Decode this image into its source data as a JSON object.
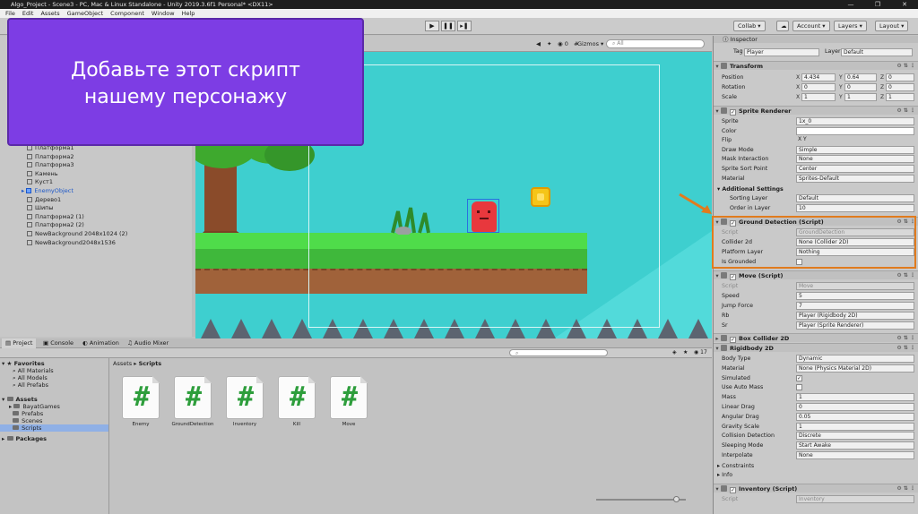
{
  "window": {
    "title": "Algo_Project - Scene3 - PC, Mac & Linux Standalone - Unity 2019.3.6f1 Personal* <DX11>",
    "menu": [
      "File",
      "Edit",
      "Assets",
      "GameObject",
      "Component",
      "Window",
      "Help"
    ]
  },
  "toolbar": {
    "collab": "Collab ▾",
    "account": "Account ▾",
    "layers": "Layers ▾",
    "layout": "Layout ▾"
  },
  "overlay": {
    "line1": "Добавьте этот скрипт",
    "line2": "нашему персонажу"
  },
  "hierarchy": {
    "items": [
      {
        "label": "Платформа1",
        "blue": false
      },
      {
        "label": "Платформа2",
        "blue": false
      },
      {
        "label": "Платформа3",
        "blue": false
      },
      {
        "label": "Камень",
        "blue": false
      },
      {
        "label": "Куст1",
        "blue": false
      },
      {
        "label": "EnemyObject",
        "blue": true
      },
      {
        "label": "Дерево1",
        "blue": false
      },
      {
        "label": "Шипы",
        "blue": false
      },
      {
        "label": "Платформа2 (1)",
        "blue": false
      },
      {
        "label": "Платформа2 (2)",
        "blue": false
      },
      {
        "label": "NewBackground 2048x1024 (2)",
        "blue": false
      },
      {
        "label": "NewBackground2048x1536",
        "blue": false
      }
    ]
  },
  "scene": {
    "gizmos": "Gizmos ▾",
    "search_placeholder": "All",
    "colors": {
      "sky": "#3ecfcf",
      "grass": "#4fdc4a",
      "dirt": "#a0623a",
      "player": "#e8383d",
      "coin": "#f5c518"
    }
  },
  "project": {
    "tabs": [
      "Project",
      "Console",
      "Animation",
      "Audio Mixer"
    ],
    "count": "17",
    "tree": {
      "favorites": "Favorites",
      "fav_items": [
        "All Materials",
        "All Models",
        "All Prefabs"
      ],
      "assets": "Assets",
      "asset_items": [
        "BayatGames",
        "Prefabs",
        "Scenes",
        "Scripts"
      ],
      "packages": "Packages"
    },
    "breadcrumb": {
      "root": "Assets",
      "sep": "▸",
      "current": "Scripts"
    },
    "files": [
      {
        "name": "Enemy"
      },
      {
        "name": "GroundDetection"
      },
      {
        "name": "Inventory"
      },
      {
        "name": "Kill"
      },
      {
        "name": "Move"
      }
    ]
  },
  "inspector": {
    "title": "Inspector",
    "tag_label": "Tag",
    "tag_value": "Player",
    "layer_label": "Layer",
    "layer_value": "Default",
    "transform": {
      "title": "Transform",
      "position": {
        "label": "Position",
        "x": "4.434",
        "y": "0.64",
        "z": "0"
      },
      "rotation": {
        "label": "Rotation",
        "x": "0",
        "y": "0",
        "z": "0"
      },
      "scale": {
        "label": "Scale",
        "x": "1",
        "y": "1",
        "z": "1"
      }
    },
    "sprite_renderer": {
      "title": "Sprite Renderer",
      "rows": [
        {
          "label": "Sprite",
          "value": "1x_0"
        },
        {
          "label": "Color",
          "value": ""
        },
        {
          "label": "Flip",
          "value": "X  Y"
        },
        {
          "label": "Draw Mode",
          "value": "Simple"
        },
        {
          "label": "Mask Interaction",
          "value": "None"
        },
        {
          "label": "Sprite Sort Point",
          "value": "Center"
        },
        {
          "label": "Material",
          "value": "Sprites-Default"
        }
      ],
      "additional": "Additional Settings",
      "sorting_layer": {
        "label": "Sorting Layer",
        "value": "Default"
      },
      "order_in_layer": {
        "label": "Order in Layer",
        "value": "10"
      }
    },
    "ground_detection": {
      "title": "Ground Detection (Script)",
      "script": {
        "label": "Script",
        "value": "GroundDetection"
      },
      "collider": {
        "label": "Collider 2d",
        "value": "None (Collider 2D)"
      },
      "platform": {
        "label": "Platform Layer",
        "value": "Nothing"
      },
      "grounded": {
        "label": "Is Grounded"
      }
    },
    "move": {
      "title": "Move (Script)",
      "script": {
        "label": "Script",
        "value": "Move"
      },
      "speed": {
        "label": "Speed",
        "value": "5"
      },
      "jump": {
        "label": "Jump Force",
        "value": "7"
      },
      "rb": {
        "label": "Rb",
        "value": "Player (Rigidbody 2D)"
      },
      "sr": {
        "label": "Sr",
        "value": "Player (Sprite Renderer)"
      }
    },
    "box_collider": {
      "title": "Box Collider 2D"
    },
    "rigidbody": {
      "title": "Rigidbody 2D",
      "rows": [
        {
          "label": "Body Type",
          "value": "Dynamic"
        },
        {
          "label": "Material",
          "value": "None (Physics Material 2D)"
        },
        {
          "label": "Simulated",
          "value": "✓"
        },
        {
          "label": "Use Auto Mass",
          "value": ""
        },
        {
          "label": "Mass",
          "value": "1"
        },
        {
          "label": "Linear Drag",
          "value": "0"
        },
        {
          "label": "Angular Drag",
          "value": "0.05"
        },
        {
          "label": "Gravity Scale",
          "value": "1"
        },
        {
          "label": "Collision Detection",
          "value": "Discrete"
        },
        {
          "label": "Sleeping Mode",
          "value": "Start Awake"
        },
        {
          "label": "Interpolate",
          "value": "None"
        }
      ],
      "constraints": "Constraints",
      "info": "Info"
    },
    "inventory": {
      "title": "Inventory (Script)",
      "script": {
        "label": "Script",
        "value": "Inventory"
      }
    }
  }
}
